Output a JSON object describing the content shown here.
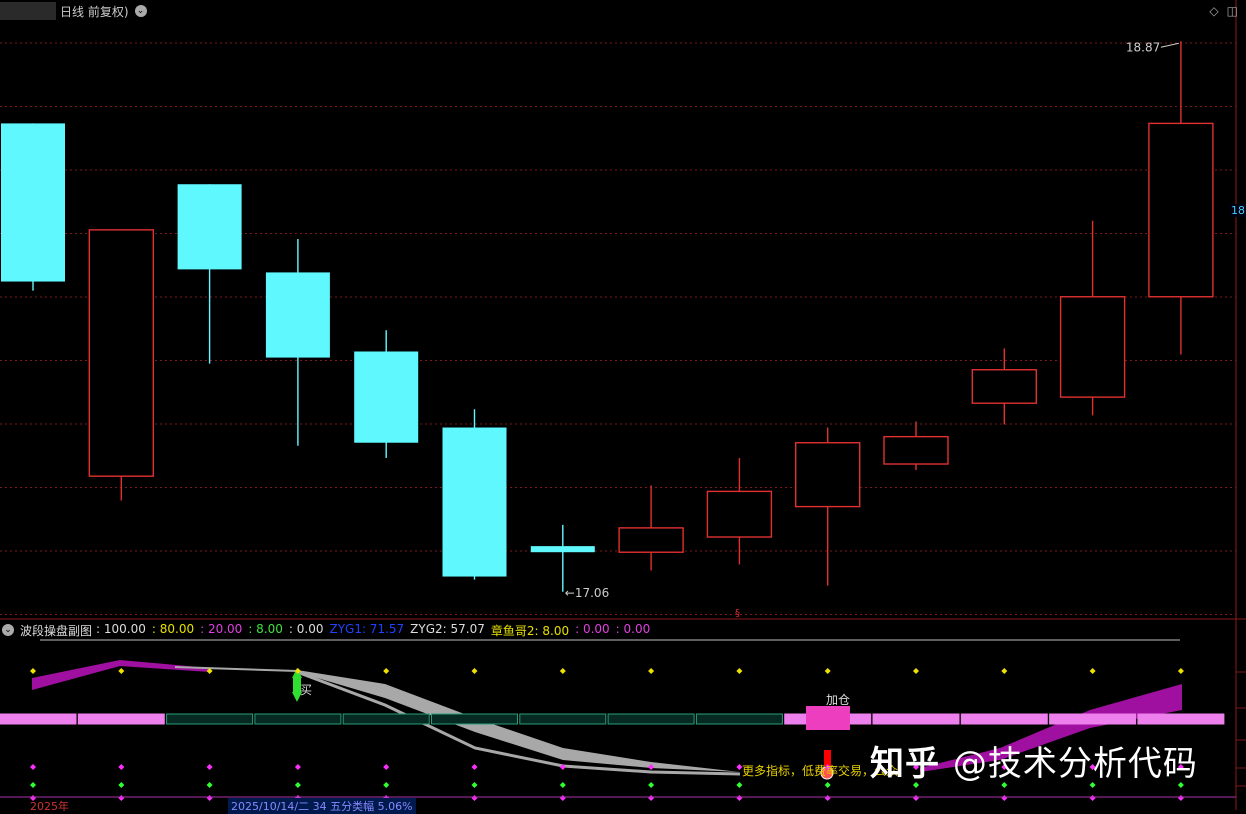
{
  "header": {
    "title_suffix": "日线 前复权)",
    "dropdown_icon": "chevron-down-icon"
  },
  "corner": {
    "diamond_icon": "◇",
    "window_icon": "◫"
  },
  "price_axis_tag": "18",
  "high_label": "18.87",
  "low_label": "←17.06",
  "sub_header": {
    "name": "波段操盘副图",
    "items": [
      {
        "text": ": 100.00",
        "color": "#dddddd"
      },
      {
        "text": ": 80.00",
        "color": "#e8e000"
      },
      {
        "text": ": 20.00",
        "color": "#e040e0"
      },
      {
        "text": ": 8.00",
        "color": "#40e040"
      },
      {
        "text": ": 0.00",
        "color": "#dddddd"
      },
      {
        "text": "ZYG1: 71.57",
        "color": "#2040ff"
      },
      {
        "text": "ZYG2: 57.07",
        "color": "#dddddd"
      },
      {
        "text": "章鱼哥2: 8.00",
        "color": "#e8e000"
      },
      {
        "text": ": 0.00",
        "color": "#e040e0"
      },
      {
        "text": ": 0.00",
        "color": "#e040e0"
      }
    ]
  },
  "signals": {
    "buy": "买",
    "add": "加仓"
  },
  "promo_text": "更多指标，低费率交易，公众",
  "watermark": {
    "brand": "知乎",
    "handle": "@技术分析代码"
  },
  "bottom": {
    "year": "2025年",
    "info": "2025/10/14/二 34 五分类幅 5.06%"
  },
  "colors": {
    "up": "#e03030",
    "down": "#5ff8ff",
    "grid": "#7a1a1a",
    "band_pink": "#ee80ee",
    "band_green": "#2a9d7a",
    "gray_ribbon": "#a8a8a8",
    "purple": "#a010a0"
  },
  "chart_data": {
    "type": "candlestick",
    "candles": [
      {
        "open": 18.08,
        "close": 18.6,
        "high": 18.6,
        "low": 18.05,
        "dir": "down"
      },
      {
        "open": 17.44,
        "close": 18.25,
        "high": 18.25,
        "low": 17.36,
        "dir": "up"
      },
      {
        "open": 18.4,
        "close": 18.12,
        "high": 18.4,
        "low": 17.81,
        "dir": "down"
      },
      {
        "open": 18.11,
        "close": 17.83,
        "high": 18.22,
        "low": 17.54,
        "dir": "down"
      },
      {
        "open": 17.85,
        "close": 17.55,
        "high": 17.92,
        "low": 17.5,
        "dir": "down"
      },
      {
        "open": 17.6,
        "close": 17.11,
        "high": 17.66,
        "low": 17.1,
        "dir": "down"
      },
      {
        "open": 17.21,
        "close": 17.19,
        "high": 17.28,
        "low": 17.06,
        "dir": "down"
      },
      {
        "open": 17.19,
        "close": 17.27,
        "high": 17.41,
        "low": 17.13,
        "dir": "up"
      },
      {
        "open": 17.24,
        "close": 17.39,
        "high": 17.5,
        "low": 17.15,
        "dir": "up"
      },
      {
        "open": 17.34,
        "close": 17.55,
        "high": 17.6,
        "low": 17.08,
        "dir": "up"
      },
      {
        "open": 17.48,
        "close": 17.57,
        "high": 17.62,
        "low": 17.46,
        "dir": "up"
      },
      {
        "open": 17.68,
        "close": 17.79,
        "high": 17.86,
        "low": 17.61,
        "dir": "up"
      },
      {
        "open": 17.7,
        "close": 18.03,
        "high": 18.28,
        "low": 17.64,
        "dir": "up"
      },
      {
        "open": 18.03,
        "close": 18.6,
        "high": 18.87,
        "low": 17.84,
        "dir": "up"
      }
    ],
    "ylim": [
      17.0,
      18.94
    ]
  }
}
